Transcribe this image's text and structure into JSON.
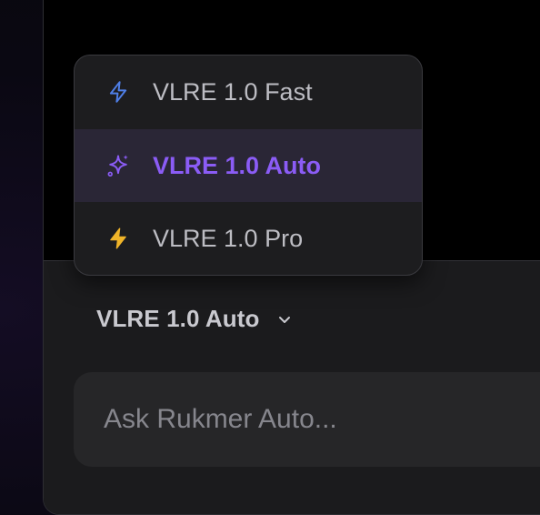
{
  "model_menu": {
    "items": [
      {
        "label": "VLRE 1.0 Fast",
        "icon": "lightning-outline-icon",
        "icon_color": "#4f7fe8",
        "selected": false
      },
      {
        "label": "VLRE 1.0 Auto",
        "icon": "sparkles-icon",
        "icon_color": "#8b5cf6",
        "selected": true
      },
      {
        "label": "VLRE 1.0 Pro",
        "icon": "lightning-filled-icon",
        "icon_color": "#f0b429",
        "selected": false
      }
    ]
  },
  "composer": {
    "selected_model_label": "VLRE 1.0 Auto",
    "prompt_placeholder": "Ask Rukmer Auto...",
    "prompt_value": ""
  },
  "colors": {
    "accent": "#8b5cf6",
    "fast_icon": "#4f7fe8",
    "pro_icon": "#f0b429",
    "menu_bg": "#1d1d1f",
    "selected_bg": "#2a2636",
    "composer_bg": "#1b1b1d",
    "input_bg": "#262628"
  }
}
